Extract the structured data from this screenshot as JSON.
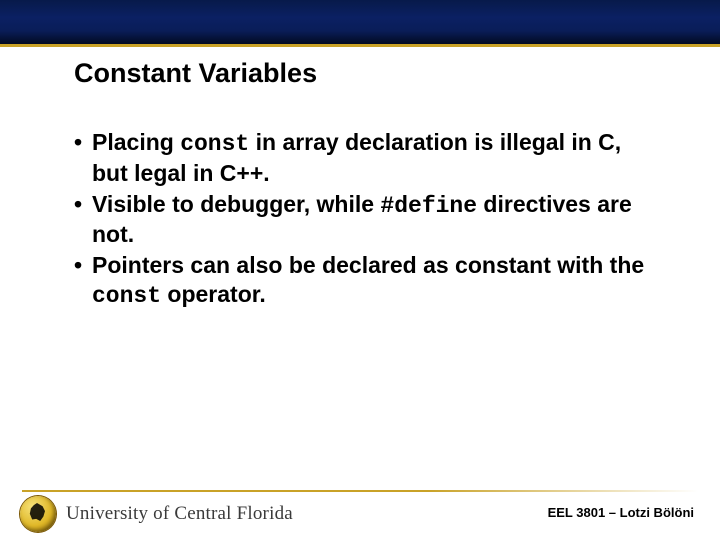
{
  "title": "Constant Variables",
  "bullets": [
    {
      "pre": "Placing ",
      "code": "const",
      "post": " in array declaration is illegal in C, but legal in C++."
    },
    {
      "pre": "Visible to debugger, while ",
      "code": "#define",
      "post": " directives are not."
    },
    {
      "pre": "Pointers can also be declared as constant with the ",
      "code": "const",
      "post": " operator."
    }
  ],
  "footer": "EEL 3801 – Lotzi Bölöni",
  "wordmark": "University of Central Florida"
}
